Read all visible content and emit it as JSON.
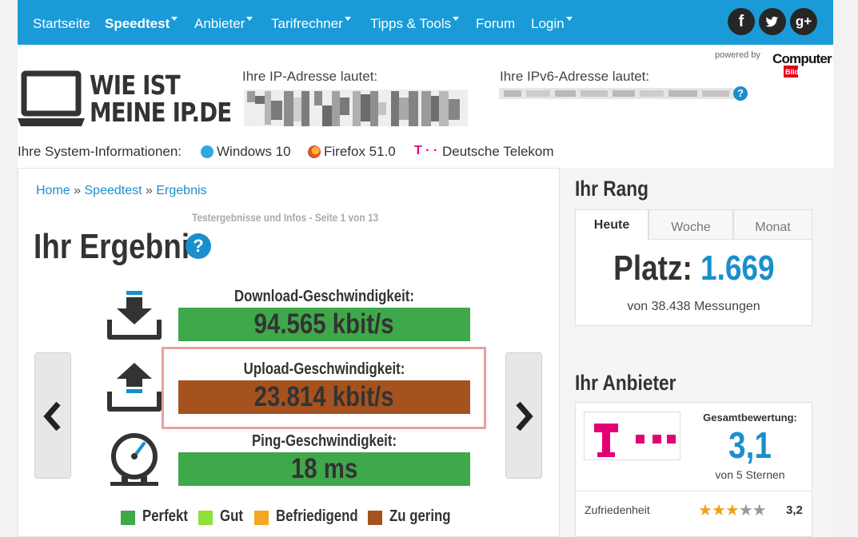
{
  "nav": {
    "items": [
      {
        "label": "Startseite",
        "dropdown": false,
        "active": false
      },
      {
        "label": "Speedtest",
        "dropdown": true,
        "active": true
      },
      {
        "label": "Anbieter",
        "dropdown": true,
        "active": false
      },
      {
        "label": "Tarifrechner",
        "dropdown": true,
        "active": false
      },
      {
        "label": "Tipps & Tools",
        "dropdown": true,
        "active": false
      },
      {
        "label": "Forum",
        "dropdown": false,
        "active": false
      },
      {
        "label": "Login",
        "dropdown": true,
        "active": false
      }
    ],
    "social": {
      "facebook": "f",
      "google": "g+"
    }
  },
  "header": {
    "logo_line1": "WIE IST",
    "logo_line2": "MEINE IP.DE",
    "ip_label": "Ihre IP-Adresse lautet:",
    "ipv6_label": "Ihre IPv6-Adresse lautet:",
    "ipv6_help": "?",
    "powered_by": "powered by",
    "partner_logo": "Computer Bild",
    "partner_logo_line1": "Computer",
    "partner_logo_line2": "Bild"
  },
  "sysinfo": {
    "label": "Ihre System-Informationen:",
    "os": "Windows 10",
    "browser": "Firefox 51.0",
    "isp": "Deutsche Telekom",
    "isp_mark": "T · ·"
  },
  "breadcrumb": {
    "home": "Home",
    "sep": "»",
    "speedtest": "Speedtest",
    "result": "Ergebnis"
  },
  "result": {
    "subtitle": "Testergebnisse und Infos - Seite 1 von 13",
    "title": "Ihr Ergebnis",
    "help": "?",
    "download_label": "Download-Geschwindigkeit:",
    "download_value": "94.565 kbit/s",
    "upload_label": "Upload-Geschwindigkeit:",
    "upload_value": "23.814 kbit/s",
    "ping_label": "Ping-Geschwindigkeit:",
    "ping_value": "18 ms",
    "prev": "‹",
    "next": "›"
  },
  "legend": [
    {
      "label": "Perfekt",
      "color": "#3fa84a"
    },
    {
      "label": "Gut",
      "color": "#8ee03a"
    },
    {
      "label": "Befriedigend",
      "color": "#f5a623"
    },
    {
      "label": "Zu gering",
      "color": "#a5521f"
    }
  ],
  "colors": {
    "nav": "#1a9bd7",
    "perfect": "#3fa84a",
    "low": "#a5521f",
    "accent": "#1a8fcd",
    "telekom": "#e20074"
  },
  "rank": {
    "title": "Ihr Rang",
    "tabs": [
      "Heute",
      "Woche",
      "Monat"
    ],
    "active_tab": "Heute",
    "prefix": "Platz:",
    "value": "1.669",
    "count": "von 38.438 Messungen"
  },
  "provider": {
    "title": "Ihr Anbieter",
    "rating_label": "Gesamtbewertung:",
    "rating": "3,1",
    "rating_sub": "von 5 Sternen",
    "satisfaction_label": "Zufriedenheit",
    "satisfaction_value": "3,2",
    "stars_filled": 3.2,
    "stars_max": 5
  }
}
